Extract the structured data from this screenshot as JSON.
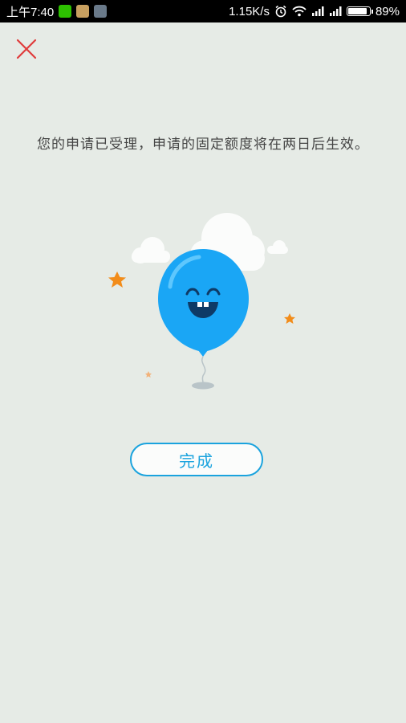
{
  "status_bar": {
    "time": "上午7:40",
    "net_speed": "1.15K/s",
    "battery_percent": "89%",
    "battery_level": 0.89,
    "icons": [
      "wechat-icon",
      "game-app-icon",
      "gallery-icon",
      "alarm-icon",
      "wifi-icon",
      "signal-icon",
      "signal-icon-2",
      "battery-icon"
    ]
  },
  "dialog": {
    "close_icon": "close-icon",
    "message": "您的申请已受理，申请的固定额度将在两日后生效。",
    "done_label": "完成"
  },
  "colors": {
    "background": "#e6ebe6",
    "accent": "#1aa3de",
    "close": "#e03c3c",
    "balloon": "#1aa6f5",
    "star": "#f28c1a"
  }
}
